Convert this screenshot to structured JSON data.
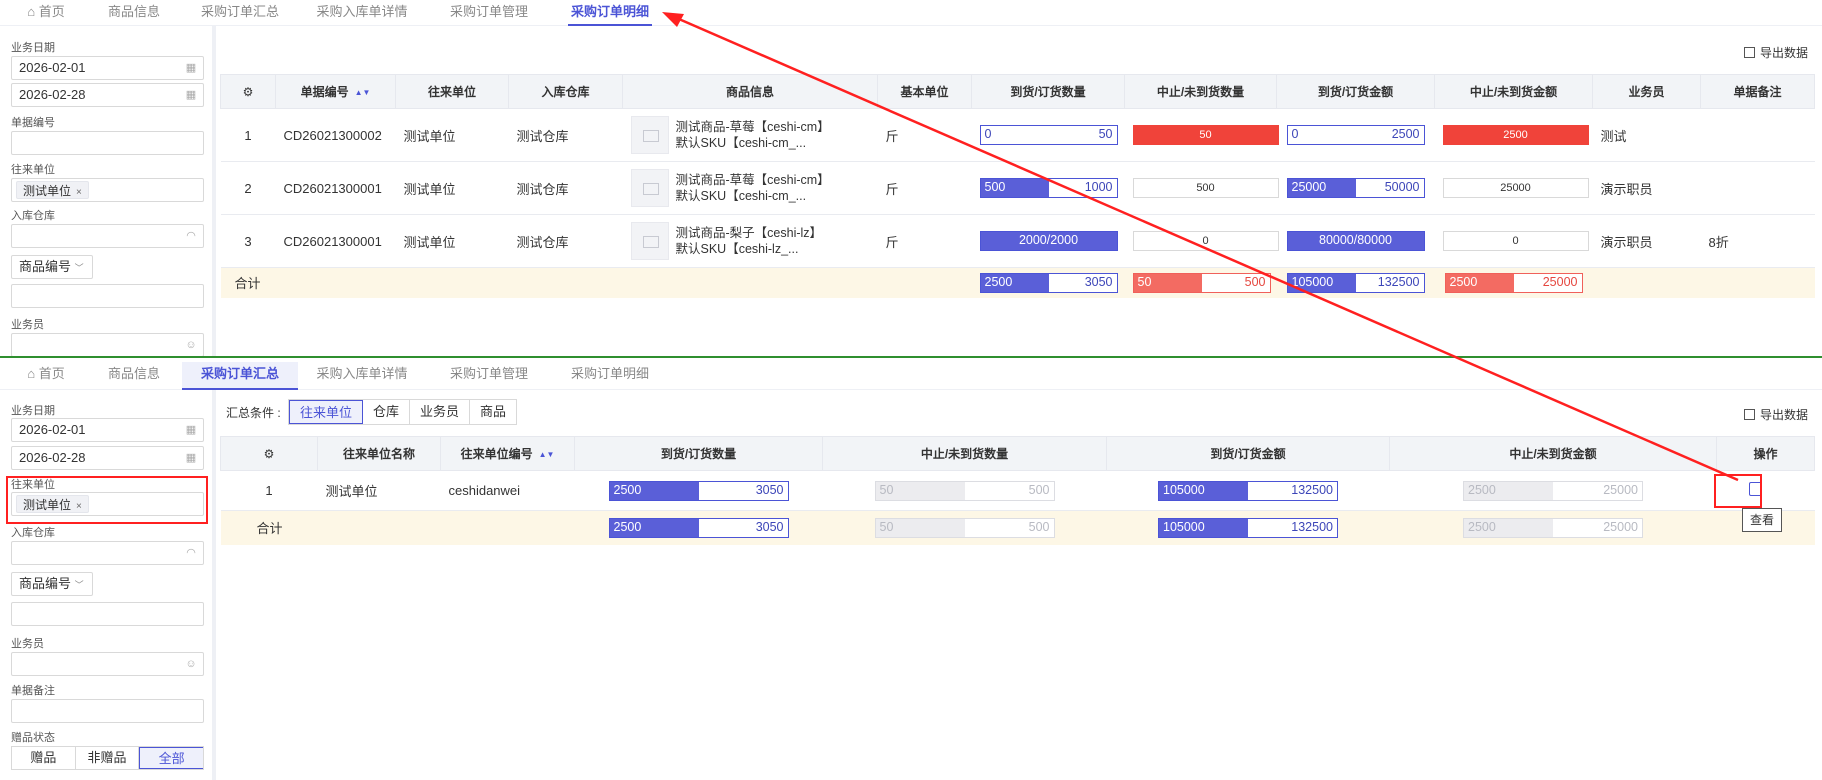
{
  "tabs_top": [
    {
      "label": "首页"
    },
    {
      "label": "商品信息"
    },
    {
      "label": "采购订单汇总"
    },
    {
      "label": "采购入库单详情"
    },
    {
      "label": "采购订单管理"
    },
    {
      "label": "采购订单明细"
    }
  ],
  "tabs_bottom": [
    {
      "label": "首页"
    },
    {
      "label": "商品信息"
    },
    {
      "label": "采购订单汇总"
    },
    {
      "label": "采购入库单详情"
    },
    {
      "label": "采购订单管理"
    },
    {
      "label": "采购订单明细"
    }
  ],
  "filters": {
    "date_label": "业务日期",
    "date_start": "2026-02-01",
    "date_end": "2026-02-28",
    "docno_label": "单据编号",
    "partner_label": "往来单位",
    "partner_chip": "测试单位",
    "chip_close": "×",
    "warehouse_label": "入库仓库",
    "product_code_btn": "商品编号",
    "salesman_label": "业务员",
    "remark_label": "单据备注",
    "gift_label": "赠品状态",
    "gift_options": [
      "赠品",
      "非赠品",
      "全部"
    ]
  },
  "export_label": "导出数据",
  "detail": {
    "headers": {
      "docno": "单据编号",
      "partner": "往来单位",
      "warehouse": "入库仓库",
      "product": "商品信息",
      "unit": "基本单位",
      "qty": "到货/订货数量",
      "stop_qty": "中止/未到货数量",
      "amount": "到货/订货金额",
      "stop_amount": "中止/未到货金额",
      "salesman": "业务员",
      "remark": "单据备注"
    },
    "rows": [
      {
        "idx": "1",
        "docno": "CD26021300002",
        "partner": "测试单位",
        "warehouse": "测试仓库",
        "product_line1": "测试商品-草莓【ceshi-cm】",
        "product_line2": "默认SKU【ceshi-cm_...",
        "unit": "斤",
        "qty_l": "0",
        "qty_r": "50",
        "qty_fill": 0,
        "stop_qty": "50",
        "amt_l": "0",
        "amt_r": "2500",
        "amt_fill": 0,
        "stop_amt": "2500",
        "salesman": "测试",
        "remark": ""
      },
      {
        "idx": "2",
        "docno": "CD26021300001",
        "partner": "测试单位",
        "warehouse": "测试仓库",
        "product_line1": "测试商品-草莓【ceshi-cm】",
        "product_line2": "默认SKU【ceshi-cm_...",
        "unit": "斤",
        "qty_l": "500",
        "qty_r": "1000",
        "qty_fill": 0.5,
        "stop_qty": "500",
        "amt_l": "25000",
        "amt_r": "50000",
        "amt_fill": 0.5,
        "stop_amt": "25000",
        "salesman": "演示职员",
        "remark": ""
      },
      {
        "idx": "3",
        "docno": "CD26021300001",
        "partner": "测试单位",
        "warehouse": "测试仓库",
        "product_line1": "测试商品-梨子【ceshi-lz】",
        "product_line2": "默认SKU【ceshi-lz_...",
        "unit": "斤",
        "qty_full": "2000/2000",
        "stop_qty": "0",
        "amt_full": "80000/80000",
        "stop_amt": "0",
        "salesman": "演示职员",
        "remark": "8折"
      }
    ],
    "total": {
      "label": "合计",
      "qty_l": "2500",
      "qty_r": "3050",
      "qty_fill": 0.5,
      "stop_qty_l": "50",
      "stop_qty_r": "500",
      "stop_qty_fill": 0.5,
      "amt_l": "105000",
      "amt_r": "132500",
      "amt_fill": 0.5,
      "stop_amt_l": "2500",
      "stop_amt_r": "25000",
      "stop_amt_fill": 0.5
    }
  },
  "summary": {
    "cond_label": "汇总条件 :",
    "cond_options": [
      "往来单位",
      "仓库",
      "业务员",
      "商品"
    ],
    "headers": {
      "partner_name": "往来单位名称",
      "partner_code": "往来单位编号",
      "qty": "到货/订货数量",
      "stop_qty": "中止/未到货数量",
      "amount": "到货/订货金额",
      "stop_amount": "中止/未到货金额",
      "op": "操作"
    },
    "row": {
      "idx": "1",
      "partner_name": "测试单位",
      "partner_code": "ceshidanwei",
      "qty_l": "2500",
      "qty_r": "3050",
      "qty_fill": 0.5,
      "stop_l": "50",
      "stop_r": "500",
      "stop_fill": 0.5,
      "amt_l": "105000",
      "amt_r": "132500",
      "amt_fill": 0.5,
      "stopamt_l": "2500",
      "stopamt_r": "25000",
      "stopamt_fill": 0.5
    },
    "total": {
      "label": "合计",
      "qty_l": "2500",
      "qty_r": "3050",
      "stop_l": "50",
      "stop_r": "500",
      "amt_l": "105000",
      "amt_r": "132500",
      "stopamt_l": "2500",
      "stopamt_r": "25000"
    },
    "tooltip": "查看"
  },
  "colors": {
    "accent": "#4b54d6",
    "danger": "#f0433a",
    "annotation": "#ff2020",
    "total_row_bg": "#fdf7e6"
  }
}
